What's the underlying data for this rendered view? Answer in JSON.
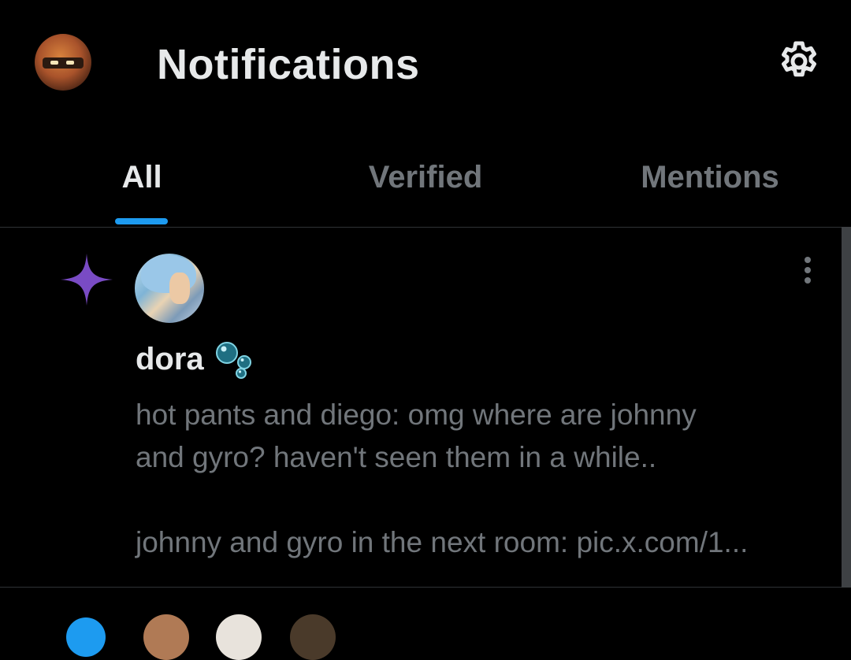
{
  "header": {
    "title": "Notifications",
    "avatar": "user-avatar",
    "settings_icon": "gear-icon"
  },
  "tabs": [
    {
      "label": "All",
      "active": true
    },
    {
      "label": "Verified",
      "active": false
    },
    {
      "label": "Mentions",
      "active": false
    }
  ],
  "notification": {
    "type_icon": "sparkle-icon",
    "author": "dora",
    "author_emoji": "bubbles-emoji",
    "text": "hot pants and diego: omg where are johnny\nand gyro? haven't seen them in a while..\n\njohnny and gyro in the next room: pic.x.com/1...",
    "more_icon": "more-vertical-icon"
  },
  "colors": {
    "background": "#000000",
    "text_primary": "#e7e9ea",
    "text_secondary": "#71767b",
    "accent": "#1d9bf0",
    "sparkle": "#794bc4",
    "divider": "#2f3336"
  }
}
